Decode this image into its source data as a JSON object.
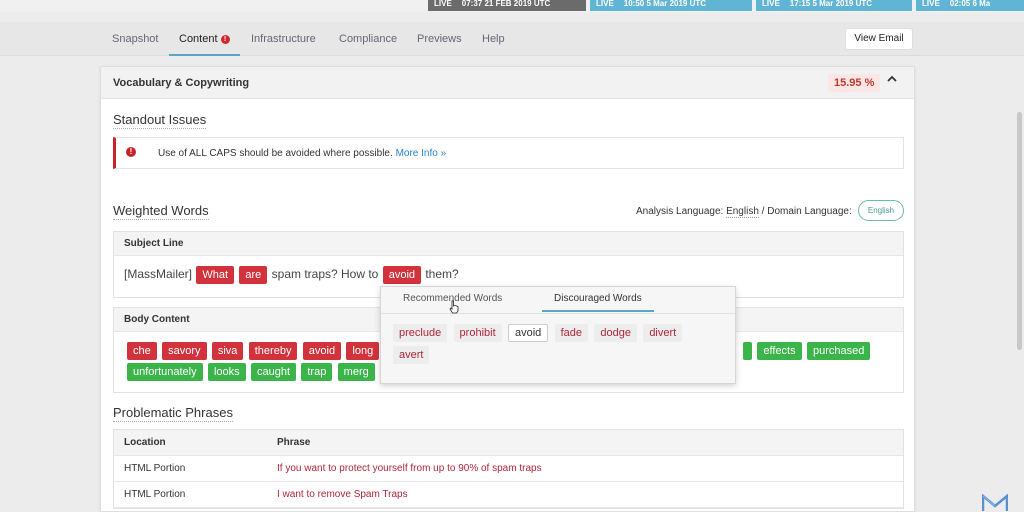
{
  "colors": {
    "accent": "#5aa6c6",
    "error": "#d2323c",
    "success": "#3bb54a",
    "live_dark": "#6b6b6b",
    "live_blue": "#5fb5d3"
  },
  "live_strip": [
    {
      "label": "LIVE",
      "time": "07:37 21 FEB 2019 UTC"
    },
    {
      "label": "LIVE",
      "time": "10:50 5 Mar 2019 UTC"
    },
    {
      "label": "LIVE",
      "time": "17:15 5 Mar 2019 UTC"
    },
    {
      "label": "LIVE",
      "time": "02:05 6 Ma"
    }
  ],
  "tabs": [
    {
      "label": "Snapshot"
    },
    {
      "label": "Content",
      "badge": "!"
    },
    {
      "label": "Infrastructure"
    },
    {
      "label": "Compliance"
    },
    {
      "label": "Previews"
    },
    {
      "label": "Help"
    }
  ],
  "view_email_label": "View Email",
  "panel": {
    "title": "Vocabulary & Copywriting",
    "score": "15.95 %",
    "caret": "⌃"
  },
  "standout": {
    "heading": "Standout Issues",
    "issue_icon": "!",
    "issue_text": "Use of ALL CAPS should be avoided where possible.",
    "issue_link": "More Info »"
  },
  "weighted": {
    "heading": "Weighted Words",
    "lang_prefix": "Analysis Language: ",
    "lang_value": "English",
    "lang_mid": " / ",
    "domain_label": "Domain Language:",
    "lang_pill": "English"
  },
  "subject": {
    "header": "Subject Line",
    "parts": [
      {
        "text": "[MassMailer]",
        "type": "plain"
      },
      {
        "text": "What",
        "type": "red"
      },
      {
        "text": "are",
        "type": "red"
      },
      {
        "text": "spam traps? How to",
        "type": "plain"
      },
      {
        "text": "avoid",
        "type": "red"
      },
      {
        "text": "them?",
        "type": "plain"
      }
    ]
  },
  "body": {
    "header": "Body Content",
    "row1": [
      {
        "text": "che",
        "type": "red"
      },
      {
        "text": "savory",
        "type": "red"
      },
      {
        "text": "siva",
        "type": "red"
      },
      {
        "text": "thereby",
        "type": "red"
      },
      {
        "text": "avoid",
        "type": "red"
      },
      {
        "text": "long",
        "type": "red"
      }
    ],
    "row1_right": [
      {
        "text": "effects",
        "type": "green"
      },
      {
        "text": "purchased",
        "type": "green"
      }
    ],
    "row2": [
      {
        "text": "unfortunately",
        "type": "green"
      },
      {
        "text": "looks",
        "type": "green"
      },
      {
        "text": "caught",
        "type": "green"
      },
      {
        "text": "trap",
        "type": "green"
      },
      {
        "text": "merg",
        "type": "green"
      }
    ]
  },
  "popup": {
    "tab_recommended": "Recommended Words",
    "tab_discouraged": "Discouraged Words",
    "words": [
      {
        "text": "preclude",
        "selected": false
      },
      {
        "text": "prohibit",
        "selected": false
      },
      {
        "text": "avoid",
        "selected": true
      },
      {
        "text": "fade",
        "selected": false
      },
      {
        "text": "dodge",
        "selected": false
      },
      {
        "text": "divert",
        "selected": false
      },
      {
        "text": "avert",
        "selected": false
      }
    ]
  },
  "problematic": {
    "heading": "Problematic Phrases",
    "col_location": "Location",
    "col_phrase": "Phrase",
    "rows": [
      {
        "location": "HTML Portion",
        "phrase": "If you want to protect yourself from up to 90% of spam traps"
      },
      {
        "location": "HTML Portion",
        "phrase": "I want to remove Spam Traps"
      }
    ]
  }
}
